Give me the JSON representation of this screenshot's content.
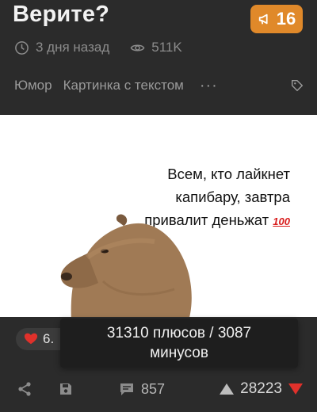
{
  "post": {
    "title": "Верите?",
    "rating": "16",
    "time_ago": "3 дня назад",
    "views": "511K",
    "tags": [
      "Юмор",
      "Картинка с текстом"
    ],
    "more_label": "···"
  },
  "image": {
    "caption_lines": [
      "Всем, кто лайкнет",
      "капибару, завтра",
      "привалит деньжат"
    ],
    "caption_emoji": "100"
  },
  "footer": {
    "likes_partial": "6.",
    "tooltip_line1": "31310 плюсов / 3087",
    "tooltip_line2": "минусов",
    "comments": "857",
    "score": "28223"
  },
  "colors": {
    "background": "#2b2b2b",
    "rating_badge": "#e0892a",
    "heart": "#e0312b",
    "downvote": "#e0312b",
    "muted_text": "#8c8c8c"
  }
}
